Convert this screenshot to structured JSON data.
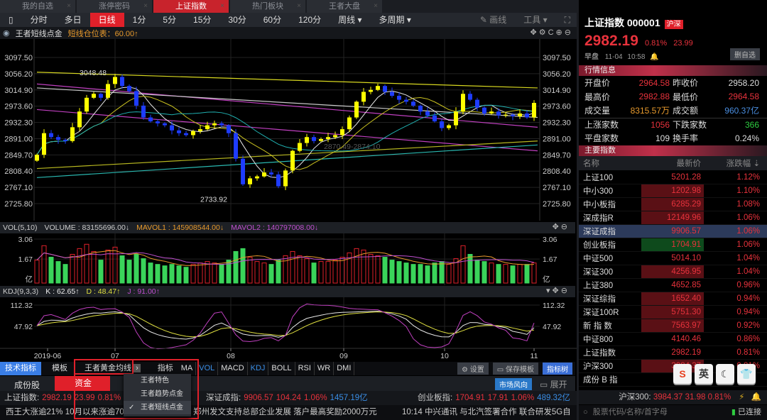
{
  "tabs": [
    {
      "label": "我的自选",
      "active": false
    },
    {
      "label": "涨停密码",
      "active": false
    },
    {
      "label": "上证指数",
      "active": true
    },
    {
      "label": "热门板块",
      "active": false
    },
    {
      "label": "王者大盘",
      "active": false
    }
  ],
  "toolbar": {
    "periods": [
      {
        "label": "分时"
      },
      {
        "label": "多日"
      },
      {
        "label": "日线",
        "active": true
      },
      {
        "label": "1分"
      },
      {
        "label": "5分"
      },
      {
        "label": "15分"
      },
      {
        "label": "30分"
      },
      {
        "label": "60分"
      },
      {
        "label": "120分"
      },
      {
        "label": "周线 ▾"
      },
      {
        "label": "多周期 ▾"
      }
    ],
    "draw_label": "画线",
    "tools_label": "工具 ▾"
  },
  "indicator_line": {
    "name": "王者短线点金",
    "value": "短线仓位表：60.00↑"
  },
  "vol_header": {
    "name": "VOL(5,10)",
    "volume": "VOLUME : 83155696.00↓",
    "mavol1": "MAVOL1 : 145908544.00↓",
    "mavol2": "MAVOL2 : 140797008.00↓"
  },
  "kdj_header": {
    "name": "KDJ(9,3,3)",
    "k": "K : 62.65↑",
    "d": "D : 48.47↑",
    "j": "J : 91.00↑"
  },
  "colors": {
    "up": "#ffff00",
    "down": "#1e3cff",
    "accent": "#e0202a",
    "vol_up": "#e0202a",
    "vol_down": "#3ad45a"
  },
  "chart_data": {
    "type": "candlestick",
    "price_ticks": [
      "3097.50",
      "3056.20",
      "3014.90",
      "2973.60",
      "2932.30",
      "2891.00",
      "2849.70",
      "2808.40",
      "2767.10",
      "2725.80"
    ],
    "price_range": [
      2725.8,
      3097.5
    ],
    "annotations": [
      {
        "label": "3048.48",
        "price": 3048.48,
        "index": 11
      },
      {
        "label": "2733.92",
        "price": 2733.92,
        "index": 29
      },
      {
        "label": "2870.49-2874.10",
        "price": 2872,
        "index": 40
      }
    ],
    "date_ticks": [
      {
        "label": "2019-06",
        "index": 1.5
      },
      {
        "label": "07",
        "index": 11
      },
      {
        "label": "08",
        "index": 27.3
      },
      {
        "label": "09",
        "index": 43.2
      },
      {
        "label": "10",
        "index": 57.4
      },
      {
        "label": "11",
        "index": 70
      }
    ],
    "closes": [
      2850,
      2905,
      2895,
      2888,
      2885,
      2920,
      2960,
      2995,
      3005,
      2995,
      3030,
      3048,
      3025,
      3012,
      2975,
      2945,
      2935,
      2930,
      2925,
      2912,
      2905,
      2900,
      2910,
      2915,
      2925,
      2930,
      2925,
      2905,
      2840,
      2775,
      2790,
      2795,
      2805,
      2800,
      2770,
      2810,
      2860,
      2880,
      2895,
      2885,
      2890,
      2895,
      2900,
      2915,
      2945,
      2985,
      3010,
      3015,
      3025,
      3010,
      3000,
      2990,
      2985,
      2975,
      2960,
      2950,
      2935,
      2918,
      2925,
      2960,
      3005,
      2990,
      2970,
      2955,
      2960,
      2950,
      2952,
      2948,
      2955,
      2945,
      2982
    ],
    "long_ma": [
      {
        "color": "#d8d820",
        "from": 3060,
        "to": 3020
      },
      {
        "color": "#c040c0",
        "from": 3030,
        "to": 2920
      },
      {
        "color": "#c8c8c8",
        "from": 3020,
        "to": 2945
      },
      {
        "color": "#c040c0",
        "from": 2965,
        "to": 2860
      },
      {
        "color": "#b8b820",
        "from": 2815,
        "to": 2885
      },
      {
        "color": "#2ab8b0",
        "from": 2792,
        "to": 2875
      }
    ],
    "volume_ticks": [
      "3.06",
      "1.67",
      "亿"
    ],
    "volume_range": [
      0,
      3.06
    ],
    "volumes": [
      1.6,
      2.6,
      1.8,
      1.5,
      1.3,
      2.0,
      2.4,
      2.7,
      2.2,
      1.6,
      2.3,
      2.5,
      1.9,
      1.6,
      2.0,
      1.7,
      1.4,
      1.3,
      1.2,
      1.3,
      1.2,
      1.1,
      1.3,
      1.4,
      1.5,
      1.4,
      1.3,
      1.6,
      2.2,
      2.4,
      1.8,
      1.5,
      1.4,
      1.3,
      1.6,
      1.9,
      2.2,
      1.9,
      1.7,
      1.4,
      1.5,
      1.5,
      1.6,
      1.8,
      2.1,
      2.4,
      2.3,
      2.0,
      1.9,
      1.8,
      1.6,
      1.5,
      1.4,
      1.3,
      1.3,
      1.2,
      1.4,
      1.5,
      1.3,
      1.7,
      2.6,
      2.0,
      1.6,
      1.5,
      1.4,
      1.3,
      1.3,
      1.2,
      1.3,
      1.3,
      1.4
    ],
    "kdj_ticks": [
      "112.32",
      "47.92"
    ],
    "kdj_scale": {
      "top": 112.32,
      "mid": 47.92
    }
  },
  "bottom_bar": {
    "tech_label": "技术指标",
    "template_label": "模板",
    "gold_ma_label": "王者黄金均线",
    "indicator_label": "指标",
    "indicators": [
      {
        "label": "MA"
      },
      {
        "label": "VOL",
        "blue": true
      },
      {
        "label": "MACD"
      },
      {
        "label": "KDJ",
        "blue": true
      },
      {
        "label": "BOLL"
      },
      {
        "label": "RSI"
      },
      {
        "label": "WR"
      },
      {
        "label": "DMI"
      }
    ],
    "settings_label": "设置",
    "save_template_label": "保存模板",
    "indicator_tree_label": "指标树"
  },
  "dropdown": {
    "items": [
      {
        "label": "王者特色",
        "checked": false
      },
      {
        "label": "王者趋势点金",
        "checked": false
      },
      {
        "label": "王者短线点金",
        "checked": true
      }
    ]
  },
  "subtabs": {
    "constituents": "成份股",
    "funds": "资金",
    "market_wind": "市场风向",
    "expand": "展开"
  },
  "ticker": [
    {
      "name": "上证指数:",
      "price": "2982.19",
      "change": "23.99",
      "pct": "0.81%",
      "amount": ""
    },
    {
      "name": "深证成指:",
      "price": "9906.57",
      "change": "104.24",
      "pct": "1.06%",
      "amount": "1457.19亿"
    },
    {
      "name": "创业板指:",
      "price": "1704.91",
      "change": "17.91",
      "pct": "1.06%",
      "amount": "489.32亿"
    }
  ],
  "news": [
    "西王大涨逾21% 10月以来涨逾70%",
    "10:31 郑州发文支持总部企业发展 落户最高奖励2000万元",
    "10:14 中兴通讯 与北汽签署合作 联合研发5G自"
  ],
  "quote": {
    "name": "上证指数 000001",
    "badge": "沪深",
    "price": "2982.19",
    "pct": "0.81%",
    "change": "23.99",
    "session": "早盘",
    "date": "11-04",
    "time": "10:58",
    "remove_label": "删自选"
  },
  "market_info": {
    "title": "行情信息",
    "rows": [
      [
        {
          "label": "开盘价",
          "value": "2964.58",
          "c": "red"
        },
        {
          "label": "昨收价",
          "value": "2958.20",
          "c": "white"
        }
      ],
      [
        {
          "label": "最高价",
          "value": "2982.88",
          "c": "red"
        },
        {
          "label": "最低价",
          "value": "2964.58",
          "c": "red"
        }
      ],
      [
        {
          "label": "成交量",
          "value": "8315.57万",
          "c": "orange"
        },
        {
          "label": "成交额",
          "value": "960.37亿",
          "c": "blue"
        }
      ],
      [
        {
          "label": "上涨家数",
          "value": "1056",
          "c": "red"
        },
        {
          "label": "下跌家数",
          "value": "366",
          "c": "green"
        }
      ],
      [
        {
          "label": "平盘家数",
          "value": "109",
          "c": "white"
        },
        {
          "label": "换手率",
          "value": "0.24%",
          "c": "white"
        }
      ]
    ]
  },
  "indices": {
    "title": "主要指数",
    "headers": [
      "名称",
      "最新价",
      "涨跌幅 ⇣"
    ],
    "rows": [
      {
        "name": "上证100",
        "price": "5201.28",
        "pct": "1.12%",
        "bg": ""
      },
      {
        "name": "中小300",
        "price": "1202.98",
        "pct": "1.10%",
        "bg": "red"
      },
      {
        "name": "中小板指",
        "price": "6285.29",
        "pct": "1.08%",
        "bg": "red"
      },
      {
        "name": "深成指R",
        "price": "12149.96",
        "pct": "1.06%",
        "bg": "red"
      },
      {
        "name": "深证成指",
        "price": "9906.57",
        "pct": "1.06%",
        "bg": "",
        "selected": true
      },
      {
        "name": "创业板指",
        "price": "1704.91",
        "pct": "1.06%",
        "bg": "green"
      },
      {
        "name": "中证500",
        "price": "5014.10",
        "pct": "1.04%",
        "bg": ""
      },
      {
        "name": "深证300",
        "price": "4256.95",
        "pct": "1.04%",
        "bg": "red"
      },
      {
        "name": "上证380",
        "price": "4652.85",
        "pct": "0.96%",
        "bg": ""
      },
      {
        "name": "深证综指",
        "price": "1652.40",
        "pct": "0.94%",
        "bg": "red"
      },
      {
        "name": "深证100R",
        "price": "5751.30",
        "pct": "0.94%",
        "bg": "red"
      },
      {
        "name": "新 指 数",
        "price": "7563.97",
        "pct": "0.92%",
        "bg": "red"
      },
      {
        "name": "中证800",
        "price": "4140.46",
        "pct": "0.86%",
        "bg": ""
      },
      {
        "name": "上证指数",
        "price": "2982.19",
        "pct": "0.81%",
        "bg": ""
      },
      {
        "name": "沪深300",
        "price": "3984.37",
        "pct": "0.81%",
        "bg": "red"
      },
      {
        "name": "成份 B 指",
        "price": "",
        "pct": "",
        "bg": ""
      }
    ]
  },
  "right_ticker": {
    "name": "沪深300:",
    "price": "3984.37",
    "change": "31.98",
    "pct": "0.81%"
  },
  "search": {
    "placeholder": "股票代码/名称/首字母",
    "status": "已连接"
  },
  "ime": {
    "keys": [
      "S",
      "英",
      "☾",
      "👕"
    ]
  }
}
